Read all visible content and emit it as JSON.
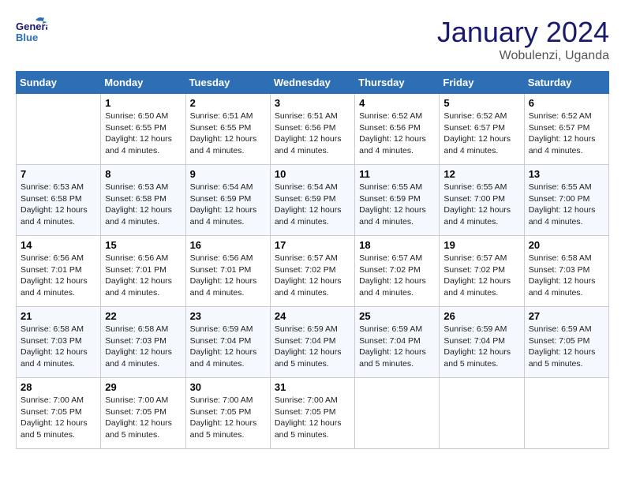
{
  "header": {
    "logo_line1": "General",
    "logo_line2": "Blue",
    "month_title": "January 2024",
    "location": "Wobulenzi, Uganda"
  },
  "days_of_week": [
    "Sunday",
    "Monday",
    "Tuesday",
    "Wednesday",
    "Thursday",
    "Friday",
    "Saturday"
  ],
  "weeks": [
    [
      {
        "day": "",
        "info": ""
      },
      {
        "day": "1",
        "info": "Sunrise: 6:50 AM\nSunset: 6:55 PM\nDaylight: 12 hours\nand 4 minutes."
      },
      {
        "day": "2",
        "info": "Sunrise: 6:51 AM\nSunset: 6:55 PM\nDaylight: 12 hours\nand 4 minutes."
      },
      {
        "day": "3",
        "info": "Sunrise: 6:51 AM\nSunset: 6:56 PM\nDaylight: 12 hours\nand 4 minutes."
      },
      {
        "day": "4",
        "info": "Sunrise: 6:52 AM\nSunset: 6:56 PM\nDaylight: 12 hours\nand 4 minutes."
      },
      {
        "day": "5",
        "info": "Sunrise: 6:52 AM\nSunset: 6:57 PM\nDaylight: 12 hours\nand 4 minutes."
      },
      {
        "day": "6",
        "info": "Sunrise: 6:52 AM\nSunset: 6:57 PM\nDaylight: 12 hours\nand 4 minutes."
      }
    ],
    [
      {
        "day": "7",
        "info": "Sunrise: 6:53 AM\nSunset: 6:58 PM\nDaylight: 12 hours\nand 4 minutes."
      },
      {
        "day": "8",
        "info": "Sunrise: 6:53 AM\nSunset: 6:58 PM\nDaylight: 12 hours\nand 4 minutes."
      },
      {
        "day": "9",
        "info": "Sunrise: 6:54 AM\nSunset: 6:59 PM\nDaylight: 12 hours\nand 4 minutes."
      },
      {
        "day": "10",
        "info": "Sunrise: 6:54 AM\nSunset: 6:59 PM\nDaylight: 12 hours\nand 4 minutes."
      },
      {
        "day": "11",
        "info": "Sunrise: 6:55 AM\nSunset: 6:59 PM\nDaylight: 12 hours\nand 4 minutes."
      },
      {
        "day": "12",
        "info": "Sunrise: 6:55 AM\nSunset: 7:00 PM\nDaylight: 12 hours\nand 4 minutes."
      },
      {
        "day": "13",
        "info": "Sunrise: 6:55 AM\nSunset: 7:00 PM\nDaylight: 12 hours\nand 4 minutes."
      }
    ],
    [
      {
        "day": "14",
        "info": "Sunrise: 6:56 AM\nSunset: 7:01 PM\nDaylight: 12 hours\nand 4 minutes."
      },
      {
        "day": "15",
        "info": "Sunrise: 6:56 AM\nSunset: 7:01 PM\nDaylight: 12 hours\nand 4 minutes."
      },
      {
        "day": "16",
        "info": "Sunrise: 6:56 AM\nSunset: 7:01 PM\nDaylight: 12 hours\nand 4 minutes."
      },
      {
        "day": "17",
        "info": "Sunrise: 6:57 AM\nSunset: 7:02 PM\nDaylight: 12 hours\nand 4 minutes."
      },
      {
        "day": "18",
        "info": "Sunrise: 6:57 AM\nSunset: 7:02 PM\nDaylight: 12 hours\nand 4 minutes."
      },
      {
        "day": "19",
        "info": "Sunrise: 6:57 AM\nSunset: 7:02 PM\nDaylight: 12 hours\nand 4 minutes."
      },
      {
        "day": "20",
        "info": "Sunrise: 6:58 AM\nSunset: 7:03 PM\nDaylight: 12 hours\nand 4 minutes."
      }
    ],
    [
      {
        "day": "21",
        "info": "Sunrise: 6:58 AM\nSunset: 7:03 PM\nDaylight: 12 hours\nand 4 minutes."
      },
      {
        "day": "22",
        "info": "Sunrise: 6:58 AM\nSunset: 7:03 PM\nDaylight: 12 hours\nand 4 minutes."
      },
      {
        "day": "23",
        "info": "Sunrise: 6:59 AM\nSunset: 7:04 PM\nDaylight: 12 hours\nand 4 minutes."
      },
      {
        "day": "24",
        "info": "Sunrise: 6:59 AM\nSunset: 7:04 PM\nDaylight: 12 hours\nand 5 minutes."
      },
      {
        "day": "25",
        "info": "Sunrise: 6:59 AM\nSunset: 7:04 PM\nDaylight: 12 hours\nand 5 minutes."
      },
      {
        "day": "26",
        "info": "Sunrise: 6:59 AM\nSunset: 7:04 PM\nDaylight: 12 hours\nand 5 minutes."
      },
      {
        "day": "27",
        "info": "Sunrise: 6:59 AM\nSunset: 7:05 PM\nDaylight: 12 hours\nand 5 minutes."
      }
    ],
    [
      {
        "day": "28",
        "info": "Sunrise: 7:00 AM\nSunset: 7:05 PM\nDaylight: 12 hours\nand 5 minutes."
      },
      {
        "day": "29",
        "info": "Sunrise: 7:00 AM\nSunset: 7:05 PM\nDaylight: 12 hours\nand 5 minutes."
      },
      {
        "day": "30",
        "info": "Sunrise: 7:00 AM\nSunset: 7:05 PM\nDaylight: 12 hours\nand 5 minutes."
      },
      {
        "day": "31",
        "info": "Sunrise: 7:00 AM\nSunset: 7:05 PM\nDaylight: 12 hours\nand 5 minutes."
      },
      {
        "day": "",
        "info": ""
      },
      {
        "day": "",
        "info": ""
      },
      {
        "day": "",
        "info": ""
      }
    ]
  ]
}
